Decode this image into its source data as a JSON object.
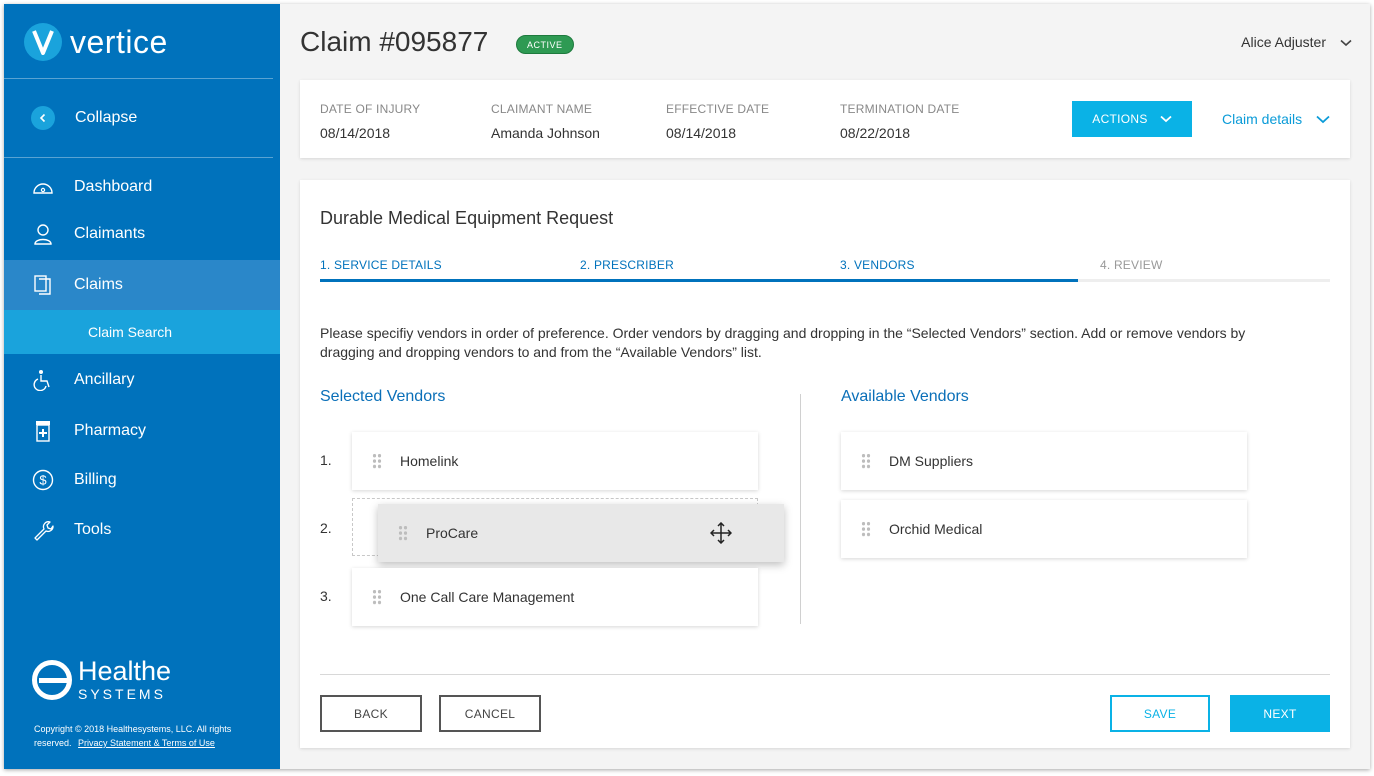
{
  "sidebar": {
    "logo_text": "vertice",
    "collapse_label": "Collapse",
    "items": [
      {
        "label": "Dashboard",
        "icon": "dashboard-icon"
      },
      {
        "label": "Claimants",
        "icon": "person-icon"
      },
      {
        "label": "Claims",
        "icon": "documents-icon"
      },
      {
        "label": "Ancillary",
        "icon": "wheelchair-icon"
      },
      {
        "label": "Pharmacy",
        "icon": "pharmacy-icon"
      },
      {
        "label": "Billing",
        "icon": "dollar-icon"
      },
      {
        "label": "Tools",
        "icon": "wrench-icon"
      }
    ],
    "sub_item": "Claim Search",
    "footer_logo_main": "Healthe",
    "footer_logo_sub": "SYSTEMS",
    "copyright": "Copyright ©  2018 Healthesystems, LLC. All rights reserved.",
    "privacy_link": "Privacy Statement & Terms of Use"
  },
  "header": {
    "title": "Claim #095877",
    "status": "ACTIVE",
    "user": "Alice Adjuster"
  },
  "summary": {
    "fields": [
      {
        "label": "DATE OF INJURY",
        "value": "08/14/2018"
      },
      {
        "label": "CLAIMANT NAME",
        "value": "Amanda Johnson"
      },
      {
        "label": "EFFECTIVE DATE",
        "value": "08/14/2018"
      },
      {
        "label": "TERMINATION DATE",
        "value": "08/22/2018"
      }
    ],
    "actions_label": "ACTIONS",
    "details_label": "Claim details"
  },
  "form": {
    "title": "Durable Medical Equipment Request",
    "steps": [
      "1. SERVICE DETAILS",
      "2. PRESCRIBER",
      "3. VENDORS",
      "4. REVIEW"
    ],
    "current_step": 3,
    "progress_fraction": 0.75,
    "instructions": "Please specifiy vendors in order of preference. Order vendors by dragging and dropping in the “Selected Vendors” section. Add or remove vendors by dragging and dropping vendors to and from the “Available Vendors” list.",
    "selected_title": "Selected Vendors",
    "available_title": "Available Vendors",
    "selected": [
      {
        "num": "1.",
        "name": "Homelink"
      },
      {
        "num": "2.",
        "name": "ProCare"
      },
      {
        "num": "3.",
        "name": "One Call Care Management"
      }
    ],
    "available": [
      "DM Suppliers",
      "Orchid Medical"
    ],
    "buttons": {
      "back": "BACK",
      "cancel": "CANCEL",
      "save": "SAVE",
      "next": "NEXT"
    }
  },
  "colors": {
    "sidebar": "#0072bc",
    "accent": "#0ab2e6",
    "active_badge": "#2e9a53"
  }
}
